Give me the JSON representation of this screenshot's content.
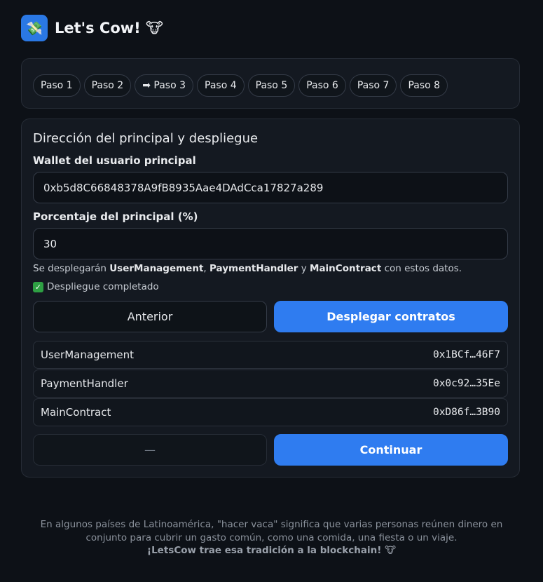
{
  "app": {
    "logo_emoji": "💸",
    "title": "Let's Cow! 🐮"
  },
  "steps": [
    {
      "label": "Paso 1",
      "active": false
    },
    {
      "label": "Paso 2",
      "active": false
    },
    {
      "label": "➡ Paso 3",
      "active": true
    },
    {
      "label": "Paso 4",
      "active": false
    },
    {
      "label": "Paso 5",
      "active": false
    },
    {
      "label": "Paso 6",
      "active": false
    },
    {
      "label": "Paso 7",
      "active": false
    },
    {
      "label": "Paso 8",
      "active": false
    }
  ],
  "section": {
    "title": "Dirección del principal y despliegue",
    "wallet_label": "Wallet del usuario principal",
    "wallet_value": "0xb5d8C66848378A9fB8935Aae4DAdCca17827a289",
    "percent_label": "Porcentaje del principal (%)",
    "percent_value": "30",
    "info_prefix": "Se desplegarán ",
    "info_c1": "UserManagement",
    "info_sep1": ", ",
    "info_c2": "PaymentHandler",
    "info_sep2": " y ",
    "info_c3": "MainContract",
    "info_suffix": " con estos datos.",
    "status_icon": "check-icon",
    "status_text": "Despliegue completado",
    "status_color": "#2ea043"
  },
  "actions": {
    "previous_label": "Anterior",
    "deploy_label": "Desplegar contratos",
    "placeholder_label": "—",
    "continue_label": "Continuar"
  },
  "contracts": [
    {
      "name": "UserManagement",
      "address": "0x1BCf…46F7"
    },
    {
      "name": "PaymentHandler",
      "address": "0x0c92…35Ee"
    },
    {
      "name": "MainContract",
      "address": "0xD86f…3B90"
    }
  ],
  "footer": {
    "line1": "En algunos países de Latinoamérica, \"hacer vaca\" significa que varias personas reúnen dinero en",
    "line2": "conjunto para cubrir un gasto común, como una comida, una fiesta o un viaje.",
    "tagline": "¡LetsCow trae esa tradición a la blockchain! 🐮"
  },
  "colors": {
    "background": "#0d1117",
    "card": "#141921",
    "accent": "#2f7cf0",
    "logo_bg": "#2a78e4"
  }
}
